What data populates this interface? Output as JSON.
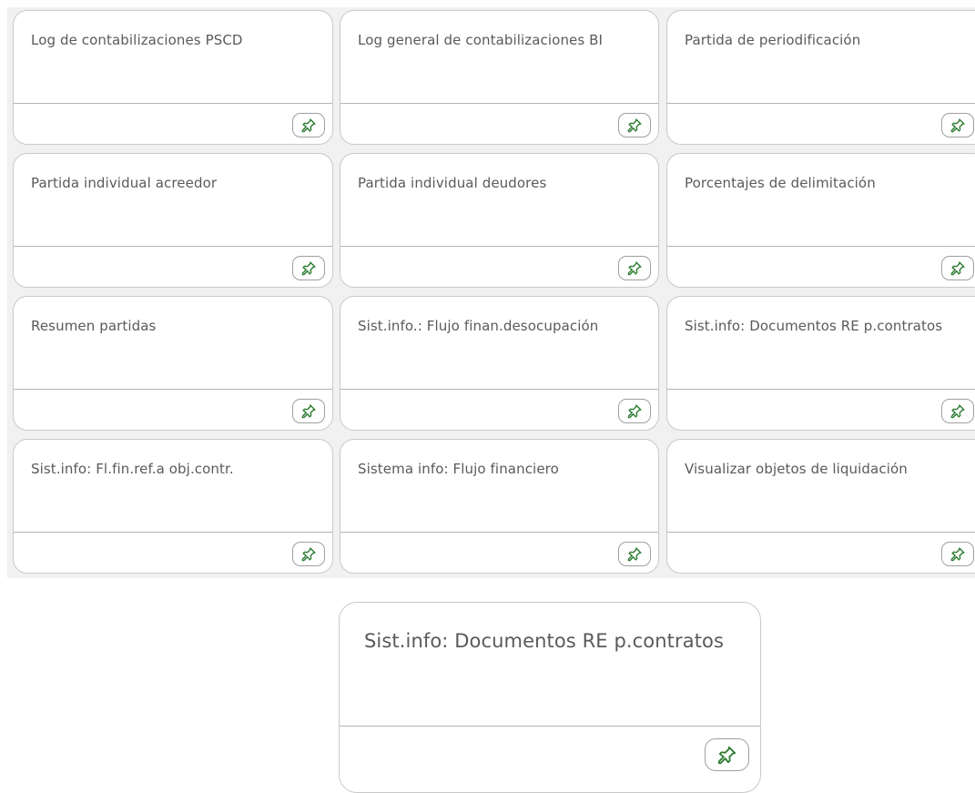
{
  "tiles": [
    {
      "title": "Log de contabilizaciones PSCD"
    },
    {
      "title": "Log general de contabilizaciones BI"
    },
    {
      "title": "Partida de periodificación"
    },
    {
      "title": "Partida individual acreedor"
    },
    {
      "title": "Partida individual deudores"
    },
    {
      "title": "Porcentajes de delimitación"
    },
    {
      "title": "Resumen partidas"
    },
    {
      "title": "Sist.info.: Flujo finan.desocupación"
    },
    {
      "title": "Sist.info: Documentos RE p.contratos"
    },
    {
      "title": "Sist.info: Fl.fin.ref.a obj.contr."
    },
    {
      "title": "Sistema info: Flujo financiero"
    },
    {
      "title": "Visualizar objetos de liquidación"
    }
  ],
  "zoom_tile": {
    "title": "Sist.info: Documentos RE p.contratos"
  },
  "icons": {
    "pin": "pin-icon"
  },
  "colors": {
    "pin_icon": "#2e7d32",
    "tile_border": "#c9c9c9",
    "grid_background": "#f1f1f1"
  }
}
